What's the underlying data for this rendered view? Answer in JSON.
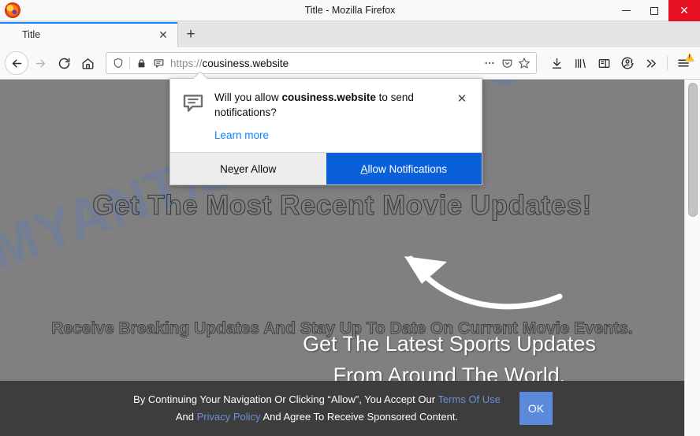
{
  "window": {
    "title": "Title - Mozilla Firefox",
    "logo_icon": "firefox-logo",
    "minimize_label": "—",
    "maximize_label": "□",
    "close_label": "✕"
  },
  "tabstrip": {
    "tab_label": "Title",
    "tab_close_label": "✕",
    "new_tab_label": "+"
  },
  "navbar": {
    "back_icon": "back-arrow-icon",
    "forward_icon": "forward-arrow-icon",
    "reload_icon": "reload-icon",
    "home_icon": "home-icon",
    "url_scheme": "https://",
    "url_host": "cousiness.website",
    "shield_icon": "tracking-protection-shield-icon",
    "lock_icon": "padlock-icon",
    "notification_icon": "notification-permission-icon",
    "page_actions_icon": "ellipsis-icon",
    "pocket_icon": "pocket-icon",
    "bookmark_icon": "star-icon",
    "downloads_icon": "download-icon",
    "library_icon": "library-icon",
    "sidebar_icon": "sidebar-icon",
    "account_icon": "account-warning-icon",
    "overflow_icon": "double-chevron-right-icon",
    "menu_icon": "hamburger-menu-icon",
    "menu_badge_icon": "warning-triangle-icon"
  },
  "doorhanger": {
    "icon": "speech-bubble-notification-icon",
    "question_prefix": "Will you allow ",
    "question_host": "cousiness.website",
    "question_suffix": " to send notifications?",
    "learn_more": "Learn more",
    "close_label": "✕",
    "never_allow_before": "Ne",
    "never_allow_key": "v",
    "never_allow_after": "er Allow",
    "allow_key": "A",
    "allow_after": "llow Notifications"
  },
  "page": {
    "watermark": "MYANTISPYWARE.COM",
    "headline_movie": "Get The Most Recent Movie Updates!",
    "headline_sports_line1": "Get The Latest Sports Updates",
    "headline_sports_line2": "From Around The World.",
    "subtext": "Receive Breaking Updates And Stay Up To Date On Current Movie Events.",
    "arrow_icon": "curved-arrow-pointing-to-allow-button"
  },
  "cookiebar": {
    "text_part1": "By Continuing Your Navigation Or Clicking “Allow”, You Accept Our ",
    "link_terms": "Terms Of Use",
    "text_part2": " And ",
    "link_privacy": "Privacy Policy",
    "text_part3": " And Agree To Receive Sponsored Content.",
    "ok_label": "OK"
  },
  "colors": {
    "page_background": "#808080",
    "cookiebar_background": "#3d3d3d",
    "primary_button": "#0a60d8",
    "ok_button": "#5b89db",
    "link": "#6c8fd6",
    "learn_more_link": "#0a84ff",
    "tab_accent": "#0a84ff",
    "close_button": "#e81123",
    "warning_badge": "#ffbd2e",
    "watermark": "#5678c3"
  }
}
